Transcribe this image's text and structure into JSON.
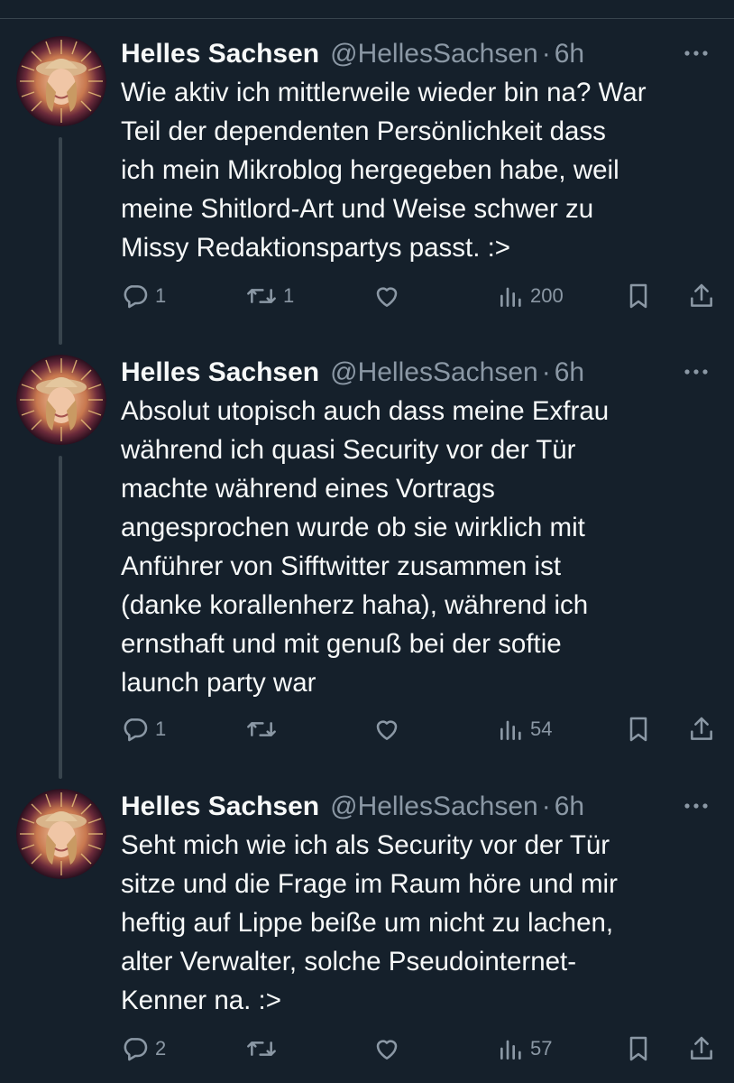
{
  "colors": {
    "background": "#15202b",
    "text": "#f7f9f9",
    "secondary": "#8b98a5",
    "thread_line": "#38444d"
  },
  "tweets": [
    {
      "name": "Helles Sachsen",
      "handle": "@HellesSachsen",
      "separator": "·",
      "time": "6h",
      "text_lines": [
        "Wie aktiv ich mittlerweile wieder bin na? War",
        "Teil der dependenten Persönlichkeit dass",
        "ich mein Mikroblog hergegeben habe, weil",
        "meine Shitlord-Art und Weise schwer zu",
        "Missy Redaktionspartys passt. :>"
      ],
      "replies": "1",
      "reposts": "1",
      "likes": "",
      "views": "200"
    },
    {
      "name": "Helles Sachsen",
      "handle": "@HellesSachsen",
      "separator": "·",
      "time": "6h",
      "text_lines": [
        "Absolut utopisch auch dass meine Exfrau",
        "während ich quasi Security vor der Tür",
        "machte während eines Vortrags",
        "angesprochen wurde ob sie wirklich mit",
        "Anführer von Sifftwitter zusammen ist",
        "(danke korallenherz haha), während ich",
        "ernsthaft und mit genuß bei der softie",
        "launch party war"
      ],
      "replies": "1",
      "reposts": "",
      "likes": "",
      "views": "54"
    },
    {
      "name": "Helles Sachsen",
      "handle": "@HellesSachsen",
      "separator": "·",
      "time": "6h",
      "text_lines": [
        "Seht mich wie ich als Security vor der Tür",
        "sitze und die Frage im Raum höre und mir",
        "heftig auf Lippe beiße um nicht zu lachen,",
        "alter Verwalter, solche Pseudointernet-",
        "Kenner na. :>"
      ],
      "replies": "2",
      "reposts": "",
      "likes": "",
      "views": "57"
    }
  ]
}
